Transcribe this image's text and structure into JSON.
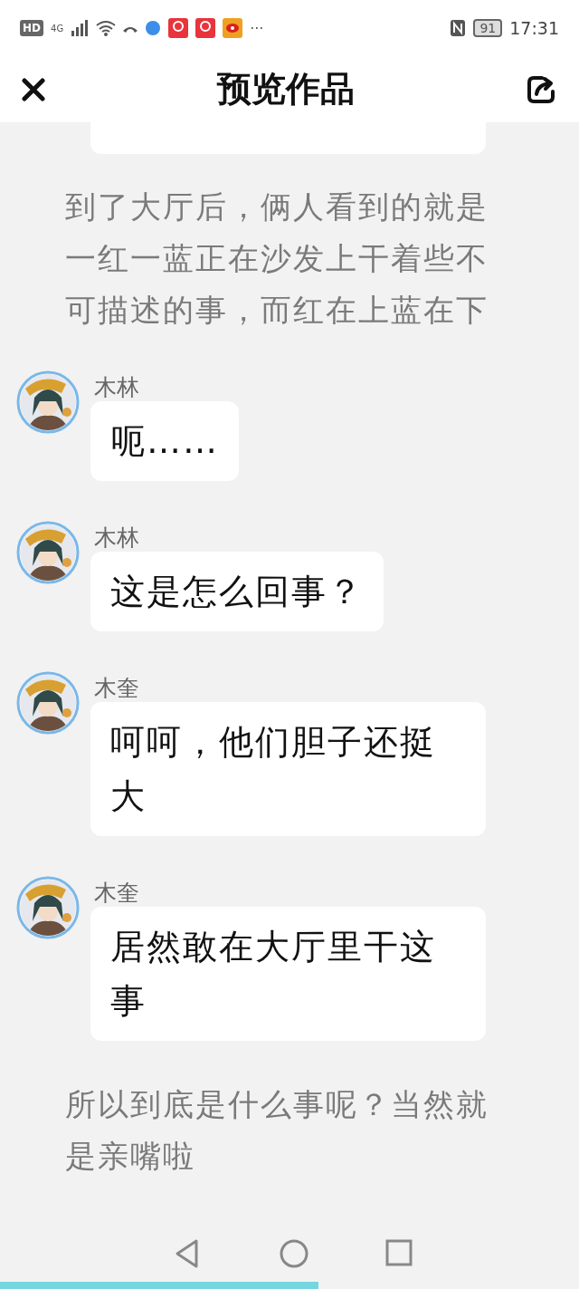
{
  "status_bar": {
    "hd": "HD",
    "network": "4G",
    "more": "···",
    "battery": "91",
    "time": "17:31"
  },
  "header": {
    "title": "预览作品"
  },
  "items": [
    {
      "kind": "cut_bubble"
    },
    {
      "kind": "narration",
      "text": "到了大厅后，俩人看到的就是一红一蓝正在沙发上干着些不可描述的事，而红在上蓝在下"
    },
    {
      "kind": "message",
      "name": "木林",
      "text": "呃……"
    },
    {
      "kind": "message",
      "name": "木林",
      "text": "这是怎么回事？"
    },
    {
      "kind": "message",
      "name": "木奎",
      "text": "呵呵，他们胆子还挺大"
    },
    {
      "kind": "message",
      "name": "木奎",
      "text": "居然敢在大厅里干这事"
    },
    {
      "kind": "narration",
      "text": "所以到底是什么事呢？当然就是亲嘴啦"
    }
  ]
}
